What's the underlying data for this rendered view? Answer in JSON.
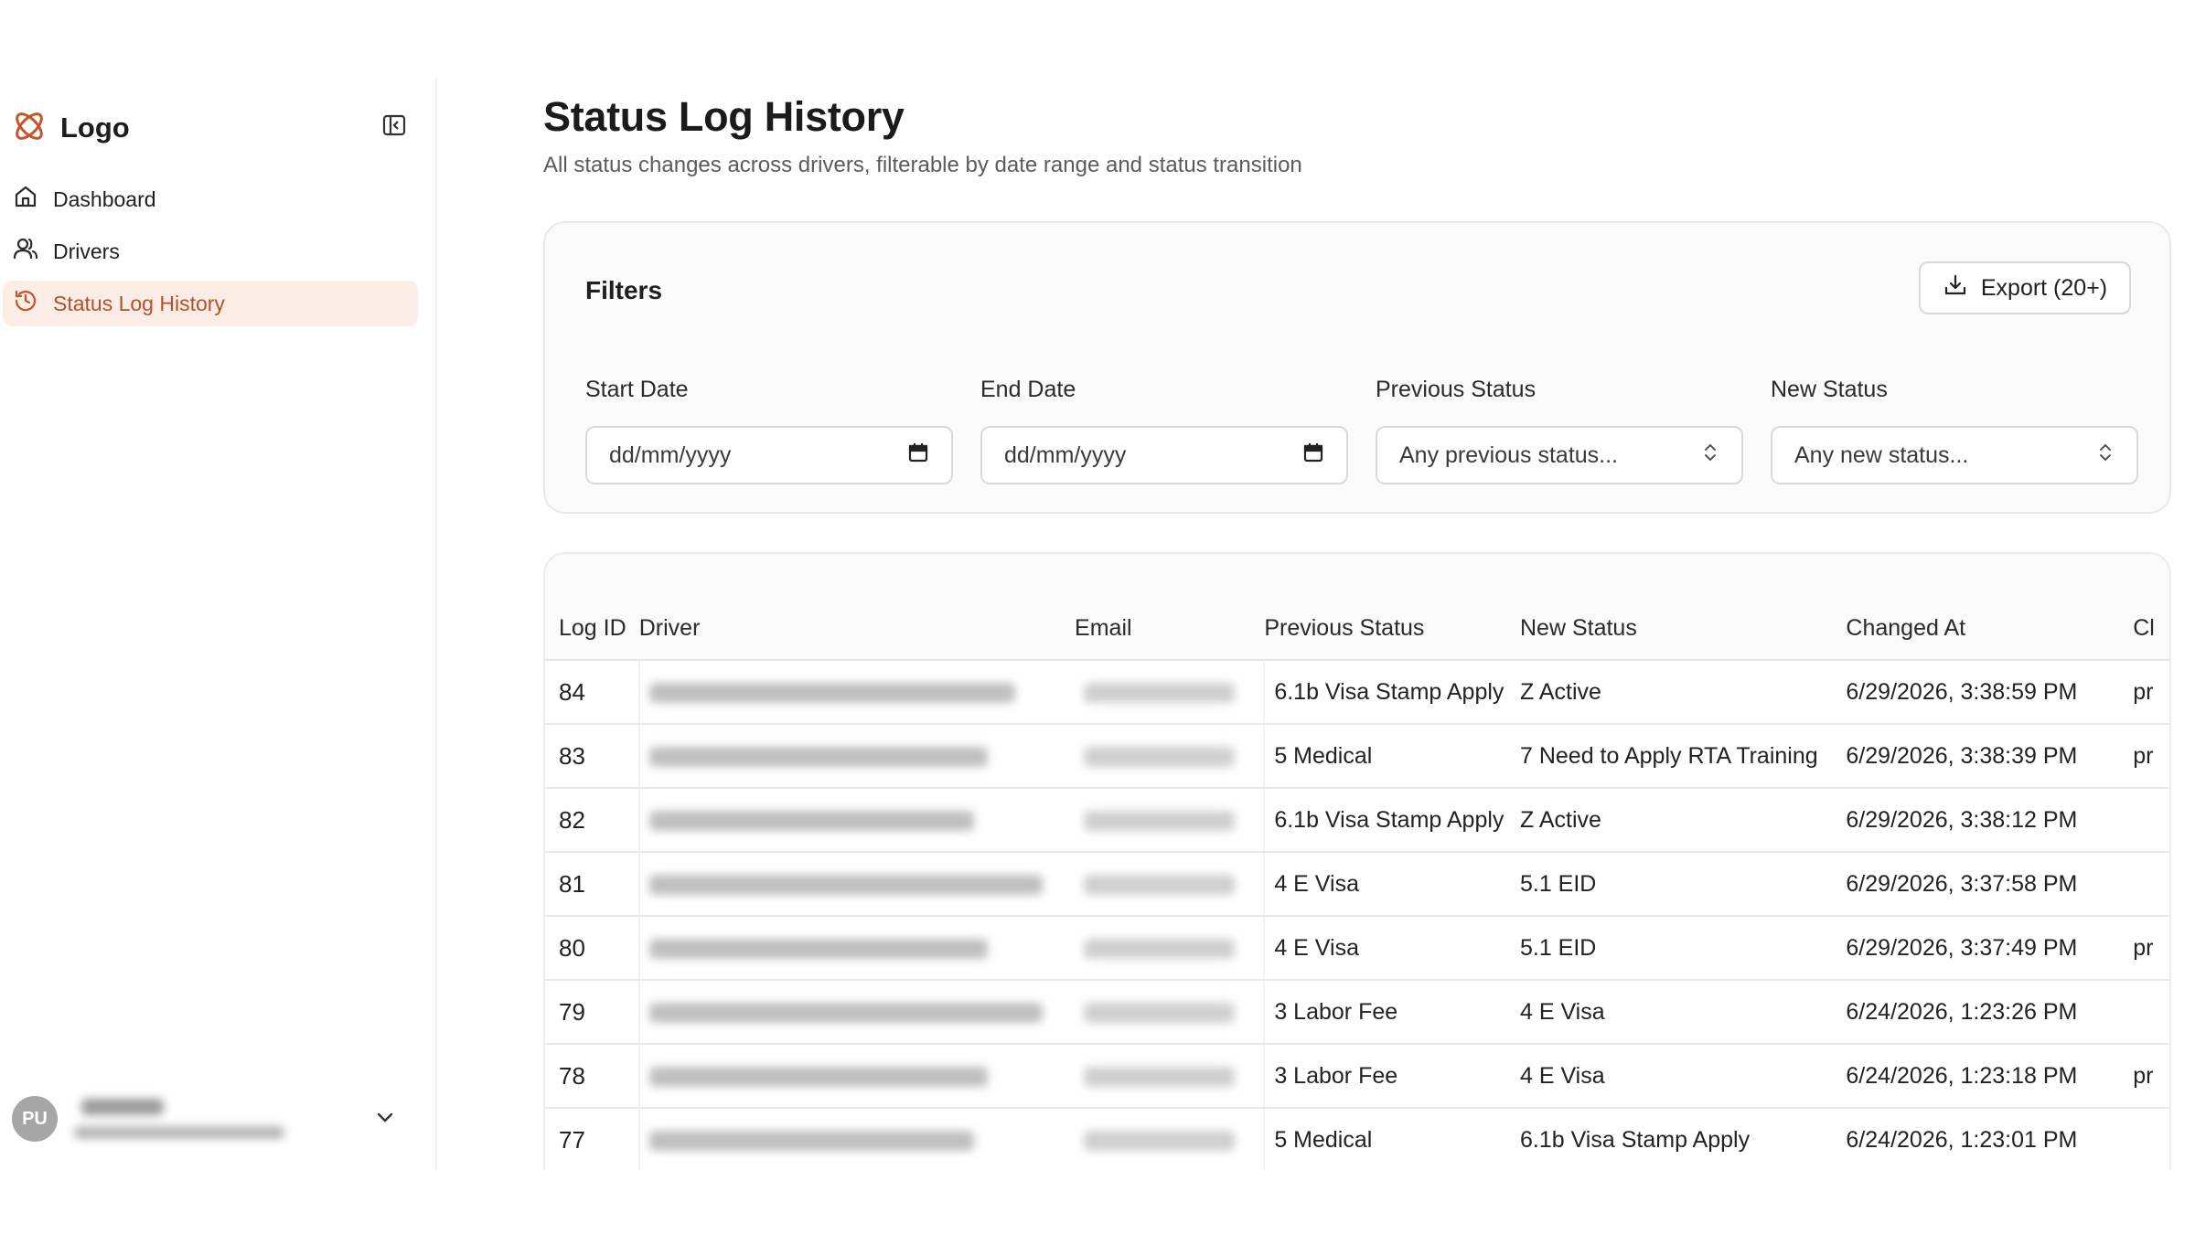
{
  "brand": {
    "name": "Logo"
  },
  "nav": {
    "items": [
      {
        "label": "Dashboard",
        "icon": "home-icon"
      },
      {
        "label": "Drivers",
        "icon": "users-icon"
      },
      {
        "label": "Status Log History",
        "icon": "clock-icon",
        "active": true
      }
    ]
  },
  "user": {
    "initials": "PU"
  },
  "page": {
    "title": "Status Log History",
    "subtitle": "All status changes across drivers, filterable by date range and status transition"
  },
  "filters": {
    "title": "Filters",
    "export_label": "Export (20+)",
    "start_date": {
      "label": "Start Date",
      "placeholder": "dd/mm/yyyy"
    },
    "end_date": {
      "label": "End Date",
      "placeholder": "dd/mm/yyyy"
    },
    "previous_status": {
      "label": "Previous Status",
      "placeholder": "Any previous status..."
    },
    "new_status": {
      "label": "New Status",
      "placeholder": "Any new status..."
    }
  },
  "table": {
    "columns": [
      "Log ID",
      "Driver",
      "Email",
      "Previous Status",
      "New Status",
      "Changed At",
      "Cl"
    ],
    "rows": [
      {
        "id": "84",
        "previous": "6.1b Visa Stamp Apply",
        "new": "Z Active",
        "changed_at": "6/29/2026, 3:38:59 PM",
        "changed_by": "pr"
      },
      {
        "id": "83",
        "previous": "5 Medical",
        "new": "7 Need to Apply RTA Training",
        "changed_at": "6/29/2026, 3:38:39 PM",
        "changed_by": "pr"
      },
      {
        "id": "82",
        "previous": "6.1b Visa Stamp Apply",
        "new": "Z Active",
        "changed_at": "6/29/2026, 3:38:12 PM",
        "changed_by": ""
      },
      {
        "id": "81",
        "previous": "4 E Visa",
        "new": "5.1 EID",
        "changed_at": "6/29/2026, 3:37:58 PM",
        "changed_by": ""
      },
      {
        "id": "80",
        "previous": "4 E Visa",
        "new": "5.1 EID",
        "changed_at": "6/29/2026, 3:37:49 PM",
        "changed_by": "pr"
      },
      {
        "id": "79",
        "previous": "3 Labor Fee",
        "new": "4 E Visa",
        "changed_at": "6/24/2026, 1:23:26 PM",
        "changed_by": ""
      },
      {
        "id": "78",
        "previous": "3 Labor Fee",
        "new": "4 E Visa",
        "changed_at": "6/24/2026, 1:23:18 PM",
        "changed_by": "pr"
      },
      {
        "id": "77",
        "previous": "5 Medical",
        "new": "6.1b Visa Stamp Apply",
        "changed_at": "6/24/2026, 1:23:01 PM",
        "changed_by": ""
      }
    ]
  },
  "colors": {
    "accent": "#c4552b",
    "active_bg": "#fbece6"
  }
}
